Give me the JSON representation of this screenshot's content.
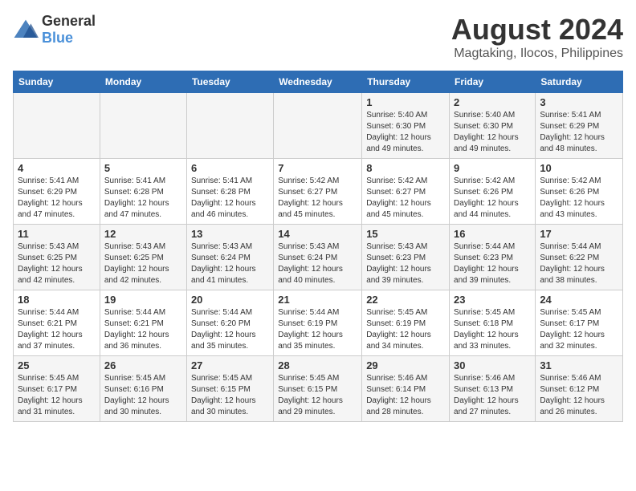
{
  "header": {
    "logo_general": "General",
    "logo_blue": "Blue",
    "main_title": "August 2024",
    "subtitle": "Magtaking, Ilocos, Philippines"
  },
  "calendar": {
    "days_of_week": [
      "Sunday",
      "Monday",
      "Tuesday",
      "Wednesday",
      "Thursday",
      "Friday",
      "Saturday"
    ],
    "weeks": [
      [
        {
          "day": "",
          "content": ""
        },
        {
          "day": "",
          "content": ""
        },
        {
          "day": "",
          "content": ""
        },
        {
          "day": "",
          "content": ""
        },
        {
          "day": "1",
          "content": "Sunrise: 5:40 AM\nSunset: 6:30 PM\nDaylight: 12 hours and 49 minutes."
        },
        {
          "day": "2",
          "content": "Sunrise: 5:40 AM\nSunset: 6:30 PM\nDaylight: 12 hours and 49 minutes."
        },
        {
          "day": "3",
          "content": "Sunrise: 5:41 AM\nSunset: 6:29 PM\nDaylight: 12 hours and 48 minutes."
        }
      ],
      [
        {
          "day": "4",
          "content": "Sunrise: 5:41 AM\nSunset: 6:29 PM\nDaylight: 12 hours and 47 minutes."
        },
        {
          "day": "5",
          "content": "Sunrise: 5:41 AM\nSunset: 6:28 PM\nDaylight: 12 hours and 47 minutes."
        },
        {
          "day": "6",
          "content": "Sunrise: 5:41 AM\nSunset: 6:28 PM\nDaylight: 12 hours and 46 minutes."
        },
        {
          "day": "7",
          "content": "Sunrise: 5:42 AM\nSunset: 6:27 PM\nDaylight: 12 hours and 45 minutes."
        },
        {
          "day": "8",
          "content": "Sunrise: 5:42 AM\nSunset: 6:27 PM\nDaylight: 12 hours and 45 minutes."
        },
        {
          "day": "9",
          "content": "Sunrise: 5:42 AM\nSunset: 6:26 PM\nDaylight: 12 hours and 44 minutes."
        },
        {
          "day": "10",
          "content": "Sunrise: 5:42 AM\nSunset: 6:26 PM\nDaylight: 12 hours and 43 minutes."
        }
      ],
      [
        {
          "day": "11",
          "content": "Sunrise: 5:43 AM\nSunset: 6:25 PM\nDaylight: 12 hours and 42 minutes."
        },
        {
          "day": "12",
          "content": "Sunrise: 5:43 AM\nSunset: 6:25 PM\nDaylight: 12 hours and 42 minutes."
        },
        {
          "day": "13",
          "content": "Sunrise: 5:43 AM\nSunset: 6:24 PM\nDaylight: 12 hours and 41 minutes."
        },
        {
          "day": "14",
          "content": "Sunrise: 5:43 AM\nSunset: 6:24 PM\nDaylight: 12 hours and 40 minutes."
        },
        {
          "day": "15",
          "content": "Sunrise: 5:43 AM\nSunset: 6:23 PM\nDaylight: 12 hours and 39 minutes."
        },
        {
          "day": "16",
          "content": "Sunrise: 5:44 AM\nSunset: 6:23 PM\nDaylight: 12 hours and 39 minutes."
        },
        {
          "day": "17",
          "content": "Sunrise: 5:44 AM\nSunset: 6:22 PM\nDaylight: 12 hours and 38 minutes."
        }
      ],
      [
        {
          "day": "18",
          "content": "Sunrise: 5:44 AM\nSunset: 6:21 PM\nDaylight: 12 hours and 37 minutes."
        },
        {
          "day": "19",
          "content": "Sunrise: 5:44 AM\nSunset: 6:21 PM\nDaylight: 12 hours and 36 minutes."
        },
        {
          "day": "20",
          "content": "Sunrise: 5:44 AM\nSunset: 6:20 PM\nDaylight: 12 hours and 35 minutes."
        },
        {
          "day": "21",
          "content": "Sunrise: 5:44 AM\nSunset: 6:19 PM\nDaylight: 12 hours and 35 minutes."
        },
        {
          "day": "22",
          "content": "Sunrise: 5:45 AM\nSunset: 6:19 PM\nDaylight: 12 hours and 34 minutes."
        },
        {
          "day": "23",
          "content": "Sunrise: 5:45 AM\nSunset: 6:18 PM\nDaylight: 12 hours and 33 minutes."
        },
        {
          "day": "24",
          "content": "Sunrise: 5:45 AM\nSunset: 6:17 PM\nDaylight: 12 hours and 32 minutes."
        }
      ],
      [
        {
          "day": "25",
          "content": "Sunrise: 5:45 AM\nSunset: 6:17 PM\nDaylight: 12 hours and 31 minutes."
        },
        {
          "day": "26",
          "content": "Sunrise: 5:45 AM\nSunset: 6:16 PM\nDaylight: 12 hours and 30 minutes."
        },
        {
          "day": "27",
          "content": "Sunrise: 5:45 AM\nSunset: 6:15 PM\nDaylight: 12 hours and 30 minutes."
        },
        {
          "day": "28",
          "content": "Sunrise: 5:45 AM\nSunset: 6:15 PM\nDaylight: 12 hours and 29 minutes."
        },
        {
          "day": "29",
          "content": "Sunrise: 5:46 AM\nSunset: 6:14 PM\nDaylight: 12 hours and 28 minutes."
        },
        {
          "day": "30",
          "content": "Sunrise: 5:46 AM\nSunset: 6:13 PM\nDaylight: 12 hours and 27 minutes."
        },
        {
          "day": "31",
          "content": "Sunrise: 5:46 AM\nSunset: 6:12 PM\nDaylight: 12 hours and 26 minutes."
        }
      ]
    ]
  }
}
